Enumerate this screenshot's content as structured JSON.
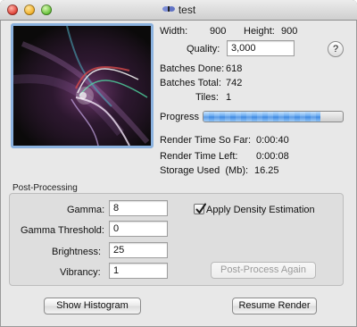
{
  "window": {
    "title": "test"
  },
  "info": {
    "width_label": "Width:",
    "width_value": "900",
    "height_label": "Height:",
    "height_value": "900",
    "quality_label": "Quality:",
    "quality_value": "3,000",
    "help_label": "?",
    "batches_done_label": "Batches Done:",
    "batches_done_value": "618",
    "batches_total_label": "Batches Total:",
    "batches_total_value": "742",
    "tiles_label": "Tiles:",
    "tiles_value": "1",
    "progress_label": "Progress",
    "progress_fraction": 0.84,
    "render_time_label": "Render Time So Far:",
    "render_time_value": "0:00:40",
    "time_left_label": "Render Time Left:",
    "time_left_value": "0:00:08",
    "storage_label": "Storage Used  (Mb):",
    "storage_value": "16.25"
  },
  "post": {
    "section_label": "Post-Processing",
    "gamma_label": "Gamma:",
    "gamma_value": "8",
    "gamma_threshold_label": "Gamma Threshold:",
    "gamma_threshold_value": "0",
    "brightness_label": "Brightness:",
    "brightness_value": "25",
    "vibrancy_label": "Vibrancy:",
    "vibrancy_value": "1",
    "density_label": "Apply Density Estimation",
    "density_checked": true,
    "again_label": "Post-Process Again"
  },
  "footer": {
    "histogram_label": "Show Histogram",
    "resume_label": "Resume Render"
  }
}
